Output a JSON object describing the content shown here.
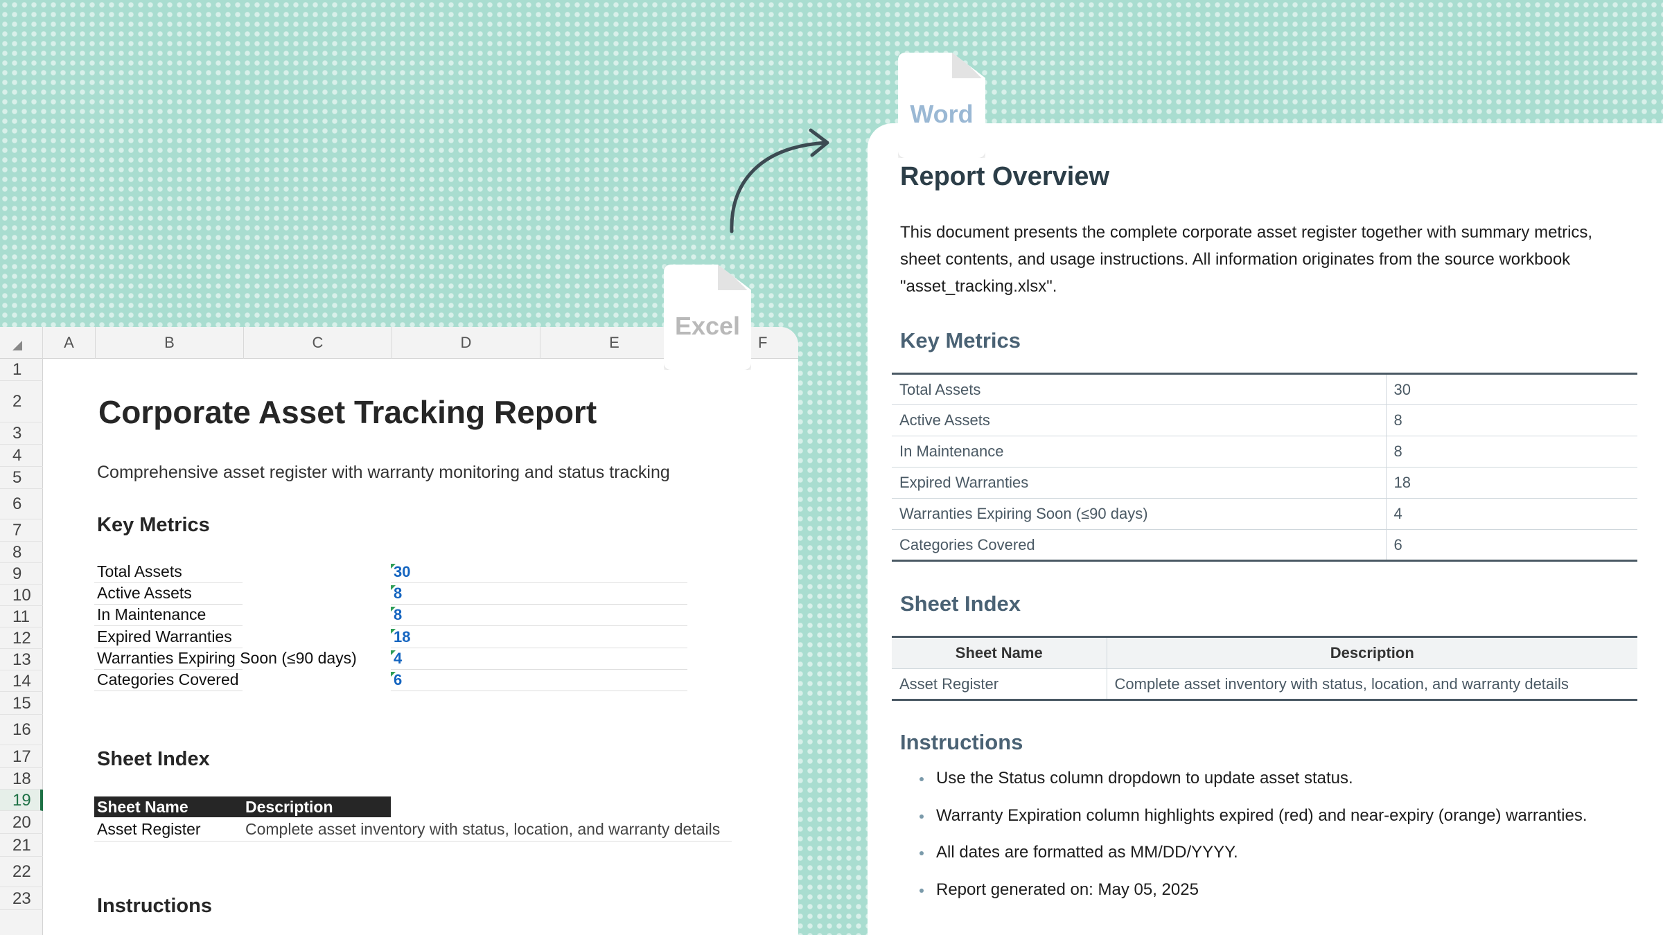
{
  "excel": {
    "icon_label": "Excel",
    "columns": [
      "A",
      "B",
      "C",
      "D",
      "E",
      "F"
    ],
    "rows": [
      "1",
      "2",
      "3",
      "4",
      "5",
      "6",
      "7",
      "8",
      "9",
      "10",
      "11",
      "12",
      "13",
      "14",
      "15",
      "16",
      "17",
      "18",
      "19",
      "20",
      "21",
      "22",
      "23"
    ],
    "selected_row": "19",
    "title": "Corporate Asset Tracking Report",
    "subtitle": "Comprehensive asset register with warranty monitoring and status tracking",
    "key_metrics_heading": "Key Metrics",
    "metrics": [
      {
        "label": "Total Assets",
        "value": "30"
      },
      {
        "label": "Active Assets",
        "value": "8"
      },
      {
        "label": "In Maintenance",
        "value": "8"
      },
      {
        "label": "Expired Warranties",
        "value": "18"
      },
      {
        "label": "Warranties Expiring Soon (≤90 days)",
        "value": "4"
      },
      {
        "label": "Categories Covered",
        "value": "6"
      }
    ],
    "sheet_index_heading": "Sheet Index",
    "sheet_header": [
      "Sheet Name",
      "Description"
    ],
    "sheet_rows": [
      {
        "name": "Asset Register",
        "description": "Complete asset inventory with status, location, and warranty details"
      }
    ],
    "instructions_heading": "Instructions"
  },
  "word": {
    "icon_label": "Word",
    "title": "Report Overview",
    "paragraph": "This document presents the complete corporate asset register together with summary metrics, sheet contents, and usage instructions. All information originates from the source workbook \"asset_tracking.xlsx\".",
    "key_metrics_heading": "Key Metrics",
    "metrics": [
      {
        "label": "Total Assets",
        "value": "30"
      },
      {
        "label": "Active Assets",
        "value": "8"
      },
      {
        "label": "In Maintenance",
        "value": "8"
      },
      {
        "label": "Expired Warranties",
        "value": "18"
      },
      {
        "label": "Warranties Expiring Soon (≤90 days)",
        "value": "4"
      },
      {
        "label": "Categories Covered",
        "value": "6"
      }
    ],
    "sheet_index_heading": "Sheet Index",
    "sheet_header": [
      "Sheet Name",
      "Description"
    ],
    "sheet_rows": [
      {
        "name": "Asset Register",
        "description": "Complete asset inventory with status, location, and warranty details"
      }
    ],
    "instructions_heading": "Instructions",
    "instructions": [
      "Use the Status column dropdown to update asset status.",
      "Warranty Expiration column highlights expired (red) and near-expiry (orange) warranties.",
      "All dates are formatted as MM/DD/YYYY.",
      "Report generated on: May 05, 2025"
    ]
  },
  "colors": {
    "background": "#a9ddd0",
    "excel_green": "#1e7145",
    "metric_value_blue": "#1565c0",
    "word_heading": "#4a6274",
    "word_icon_text": "#9ab8d4",
    "excel_icon_text": "#b9b9b9"
  },
  "icons": [
    "excel-file-icon",
    "word-file-icon",
    "conversion-arrow-icon"
  ]
}
